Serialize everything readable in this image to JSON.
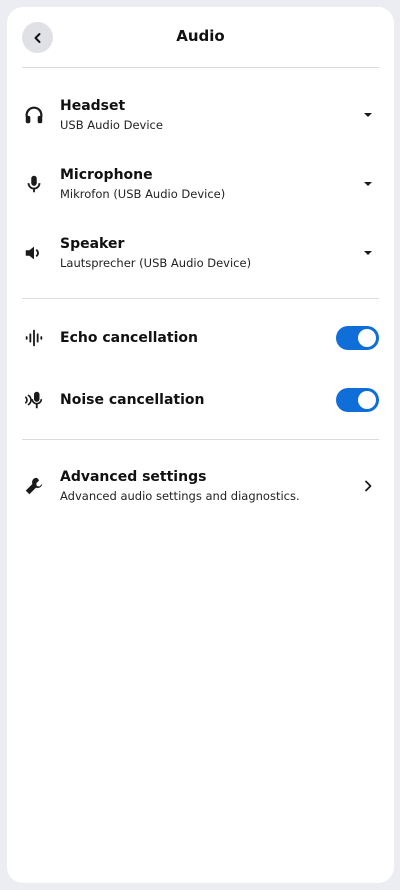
{
  "header": {
    "title": "Audio",
    "back_icon": "chevron-left-icon"
  },
  "devices": [
    {
      "label": "Headset",
      "value": "USB Audio Device",
      "icon": "headset-icon"
    },
    {
      "label": "Microphone",
      "value": "Mikrofon (USB Audio Device)",
      "icon": "microphone-icon"
    },
    {
      "label": "Speaker",
      "value": "Lautsprecher (USB Audio Device)",
      "icon": "speaker-icon"
    }
  ],
  "toggles": [
    {
      "label": "Echo cancellation",
      "enabled": true,
      "icon": "echo-cancellation-icon"
    },
    {
      "label": "Noise cancellation",
      "enabled": true,
      "icon": "noise-cancellation-icon"
    }
  ],
  "advanced": {
    "label": "Advanced settings",
    "description": "Advanced audio settings and diagnostics.",
    "icon": "wrench-icon"
  },
  "colors": {
    "accent": "#0f6ed8",
    "background": "#ebedf2",
    "panel": "#ffffff"
  }
}
